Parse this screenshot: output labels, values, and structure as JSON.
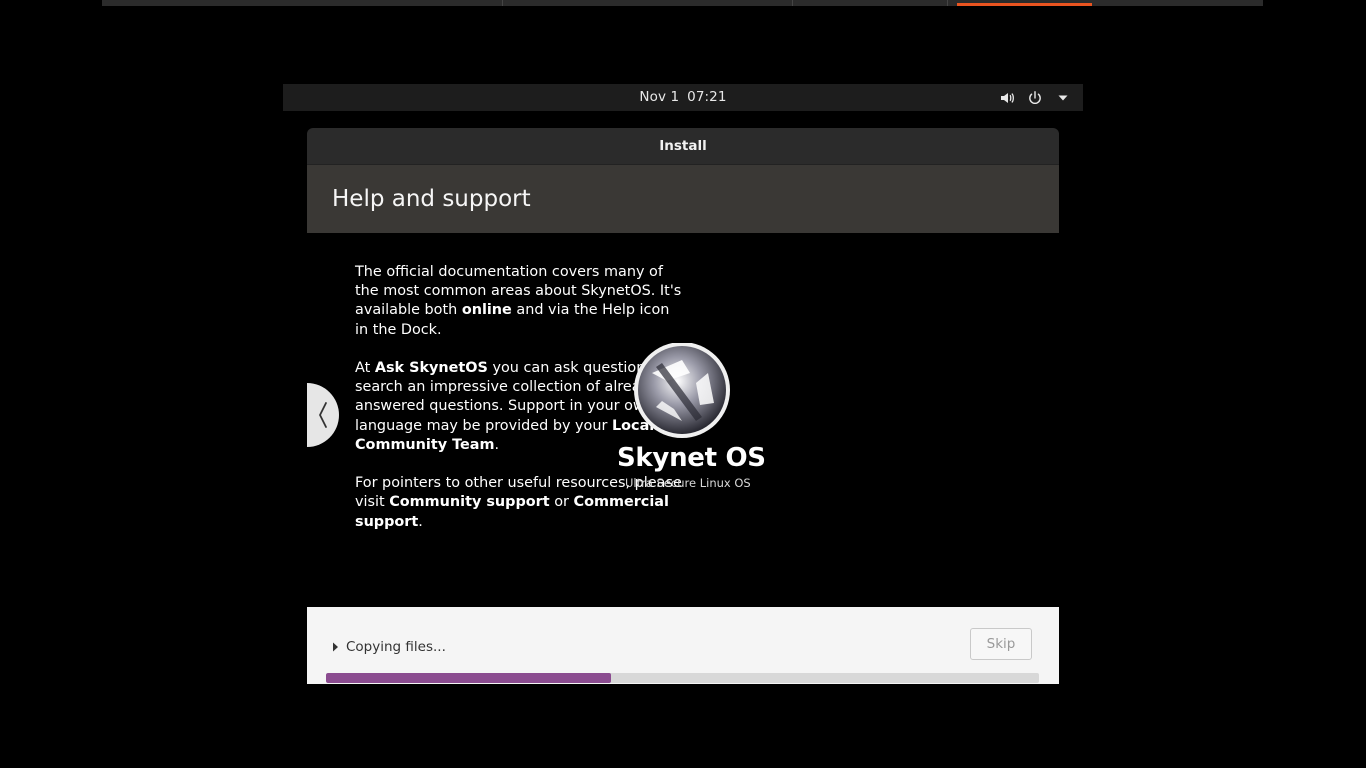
{
  "top_panel": {
    "date": "Nov 1",
    "time": "07:21",
    "icons": [
      "speaker-icon",
      "power-icon",
      "menu-triangle-icon"
    ]
  },
  "window": {
    "title": "Install",
    "header": "Help and support"
  },
  "slide": {
    "p1": {
      "t1": "The official documentation covers many of the most common areas about SkynetOS. It's available both ",
      "b1": "online",
      "t2": " and via the Help icon in the Dock."
    },
    "p2": {
      "t1": "At ",
      "b1": "Ask SkynetOS",
      "t2": " you can ask questions and search an impressive collection of already answered questions. Support in your own language may be provided by your ",
      "b2": "Local Community Team",
      "t3": "."
    },
    "p3": {
      "t1": "For pointers to other useful resources, please visit ",
      "b1": "Community support",
      "t2": " or ",
      "b2": "Commercial support",
      "t3": "."
    }
  },
  "logo": {
    "name": "Skynet OS",
    "tagline": "Ultra Secure Linux OS"
  },
  "footer": {
    "status": "Copying files...",
    "skip_label": "Skip",
    "progress": 0.4
  },
  "colors": {
    "accent": "#e95420",
    "progress": "#8b4c90"
  }
}
